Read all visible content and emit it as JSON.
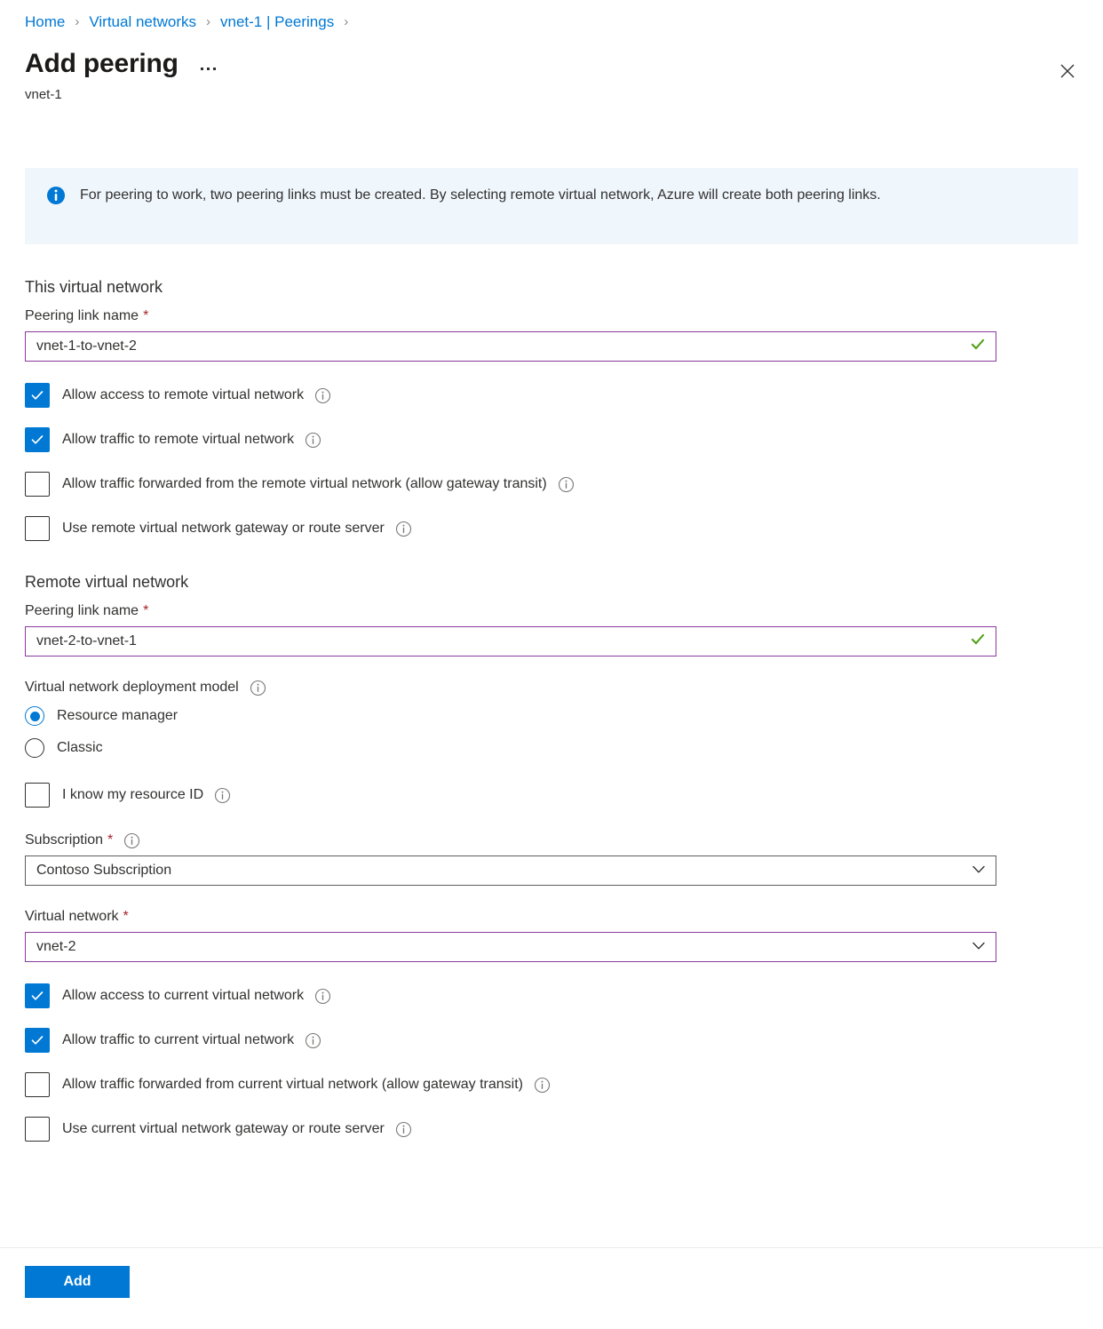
{
  "breadcrumb": {
    "items": [
      "Home",
      "Virtual networks",
      "vnet-1 | Peerings"
    ],
    "separator": "›"
  },
  "header": {
    "title": "Add peering",
    "subtitle": "vnet-1",
    "more_icon": "ellipsis-icon",
    "close_icon": "close-icon"
  },
  "info_banner": {
    "icon": "info-icon",
    "text": "For peering to work, two peering links must be created. By selecting remote virtual network, Azure will create both peering links.",
    "background": "#eff6fc",
    "icon_color": "#0078d4"
  },
  "local_section": {
    "heading": "This virtual network",
    "peering_link_name": {
      "label": "Peering link name",
      "required_marker": "*",
      "value": "vnet-1-to-vnet-2",
      "placeholder": "",
      "valid_icon": "checkmark-icon",
      "border_color": "#8b3a9e",
      "valid_color": "#107c10"
    },
    "checkboxes": [
      {
        "label": "Allow access to remote virtual network",
        "checked": true
      },
      {
        "label": "Allow traffic to remote virtual network",
        "checked": true
      },
      {
        "label": "Allow traffic forwarded from the remote virtual network (allow gateway transit)",
        "checked": false
      },
      {
        "label": "Use remote virtual network gateway or route server",
        "checked": false
      }
    ]
  },
  "remote_section": {
    "heading": "Remote virtual network",
    "peering_link_name": {
      "label": "Peering link name",
      "required_marker": "*",
      "value": "vnet-2-to-vnet-1",
      "placeholder": "",
      "valid_icon": "checkmark-icon",
      "border_color": "#8b3a9e"
    },
    "deployment_model": {
      "label": "Virtual network deployment model",
      "options": [
        {
          "label": "Resource manager",
          "selected": true
        },
        {
          "label": "Classic",
          "selected": false
        }
      ]
    },
    "resource_id_checkbox": {
      "label": "I know my resource ID",
      "checked": false
    },
    "subscription": {
      "label": "Subscription",
      "required_marker": "*",
      "value": "Contoso Subscription",
      "border_color": "#605e5c",
      "chevron_icon": "chevron-down-icon"
    },
    "virtual_network": {
      "label": "Virtual network",
      "required_marker": "*",
      "value": "vnet-2",
      "border_color": "#8b3a9e",
      "chevron_icon": "chevron-down-icon"
    },
    "checkboxes": [
      {
        "label": "Allow access to current virtual network",
        "checked": true
      },
      {
        "label": "Allow traffic to current virtual network",
        "checked": true
      },
      {
        "label": "Allow traffic forwarded from current virtual network (allow gateway transit)",
        "checked": false
      },
      {
        "label": "Use current virtual network gateway or route server",
        "checked": false
      }
    ]
  },
  "footer": {
    "add_label": "Add",
    "accent_color": "#0078d4"
  }
}
